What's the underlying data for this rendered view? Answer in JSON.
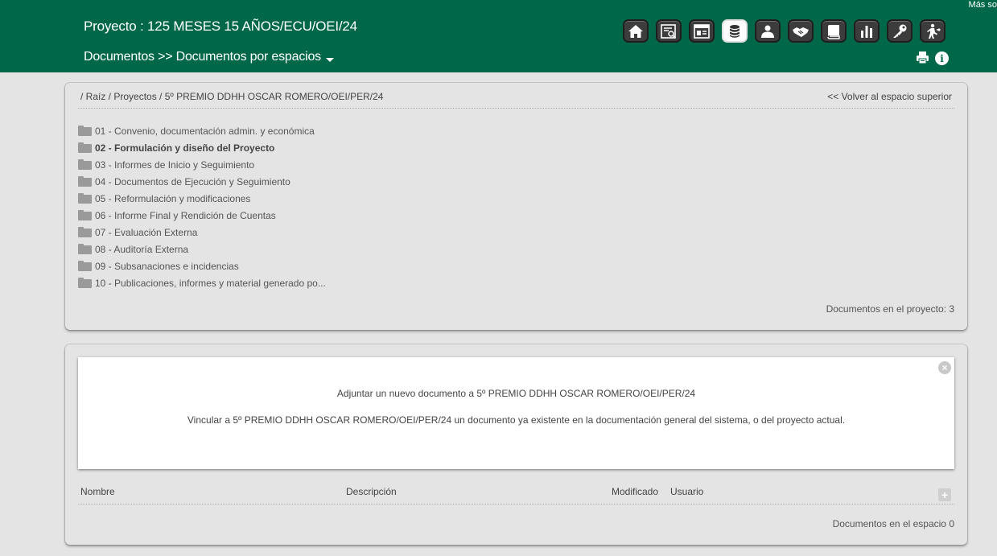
{
  "header": {
    "project_title": "Proyecto : 125 MESES 15 AÑOS/ECU/OEI/24",
    "section_title": "Documentos >> Documentos por espacios",
    "corner_text": "Más so"
  },
  "toolbar": {
    "buttons": [
      {
        "name": "home-icon",
        "active": false
      },
      {
        "name": "search-document-icon",
        "active": false
      },
      {
        "name": "calendar-icon",
        "active": false
      },
      {
        "name": "database-icon",
        "active": true
      },
      {
        "name": "user-icon",
        "active": false
      },
      {
        "name": "handshake-icon",
        "active": false
      },
      {
        "name": "book-icon",
        "active": false
      },
      {
        "name": "bar-chart-icon",
        "active": false
      },
      {
        "name": "key-icon",
        "active": false
      },
      {
        "name": "exit-icon",
        "active": false
      }
    ]
  },
  "explorer": {
    "breadcrumb": "/ Raíz / Proyectos / 5º PREMIO DDHH OSCAR ROMERO/OEI/PER/24",
    "back_link": "<< Volver al espacio superior",
    "folders": [
      {
        "label": "01 - Convenio, documentación admin. y económica",
        "bold": false
      },
      {
        "label": "02 - Formulación y diseño del Proyecto",
        "bold": true
      },
      {
        "label": "03 - Informes de Inicio y Seguimiento",
        "bold": false
      },
      {
        "label": "04 - Documentos de Ejecución y Seguimiento",
        "bold": false
      },
      {
        "label": "05 - Reformulación y modificaciones",
        "bold": false
      },
      {
        "label": "06 - Informe Final y Rendición de Cuentas",
        "bold": false
      },
      {
        "label": "07 - Evaluación Externa",
        "bold": false
      },
      {
        "label": "08 - Auditoría Externa",
        "bold": false
      },
      {
        "label": "09 - Subsanaciones e incidencias",
        "bold": false
      },
      {
        "label": "10 - Publicaciones, informes y material generado po...",
        "bold": false
      }
    ],
    "project_doc_count": "Documentos en el proyecto: 3"
  },
  "documents": {
    "attach_new": "Adjuntar un nuevo documento a 5º PREMIO DDHH OSCAR ROMERO/OEI/PER/24",
    "link_existing": "Vincular a 5º PREMIO DDHH OSCAR ROMERO/OEI/PER/24 un documento ya existente en la documentación general del sistema, o del proyecto actual.",
    "columns": {
      "name": "Nombre",
      "description": "Descripción",
      "modified": "Modificado",
      "user": "Usuario"
    },
    "space_doc_count": "Documentos en el espacio 0"
  },
  "colors": {
    "header_bg": "#006848",
    "page_bg": "#e4e4e4",
    "button_bg": "#3c3c3c",
    "active_button_bg": "#fdfdfd"
  }
}
